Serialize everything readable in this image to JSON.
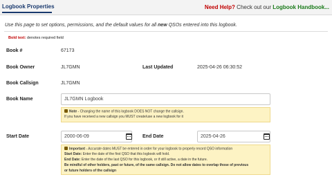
{
  "header": {
    "title": "Logbook Properties",
    "help_label": "Need Help?",
    "help_middle": "Check out our",
    "help_link": "Logbook Handbook..."
  },
  "intro": {
    "before": "Use this page to set options, permissions, and the default values for all",
    "emph": "new",
    "after": "QSOs entered into this logbook."
  },
  "required_note": {
    "bold": "Bold text:",
    "rest": "denotes required field"
  },
  "book_number": {
    "label": "Book #",
    "value": "67173"
  },
  "book_owner": {
    "label": "Book Owner",
    "value": "JL7GMN"
  },
  "last_updated": {
    "label": "Last Updated",
    "value": "2025-04-26 06:30:52"
  },
  "book_callsign": {
    "label": "Book Callsign",
    "value": "JL7GMN"
  },
  "book_name": {
    "label": "Book Name",
    "value": "JL7GMN Logbook",
    "note_title": "Note",
    "note_line1": "- Changing the name of this logbook DOES NOT change the callsign.",
    "note_line2": "If you have received a new callsign you MUST create/use a new logbook for it"
  },
  "start_date": {
    "label": "Start Date",
    "value": "2000-06-09"
  },
  "end_date": {
    "label": "End Date",
    "value": "2025-04-26"
  },
  "date_note": {
    "title": "Important",
    "line1": "- Accurate dates MUST be entered in order for your logbook to properly record QSO information",
    "start_title": "Start Date:",
    "start_text": "Enter the date of the first QSO that this logbook will hold.",
    "end_title": "End Date:",
    "end_text": "Enter the date of the last QSO for this logbook, or if still active, a date in the future.",
    "warning1": "Be mindful of other holders, past or future, of the same callsign. Do not allow dates to overlap those of previous",
    "warning2": "or future holders of the callsign"
  }
}
